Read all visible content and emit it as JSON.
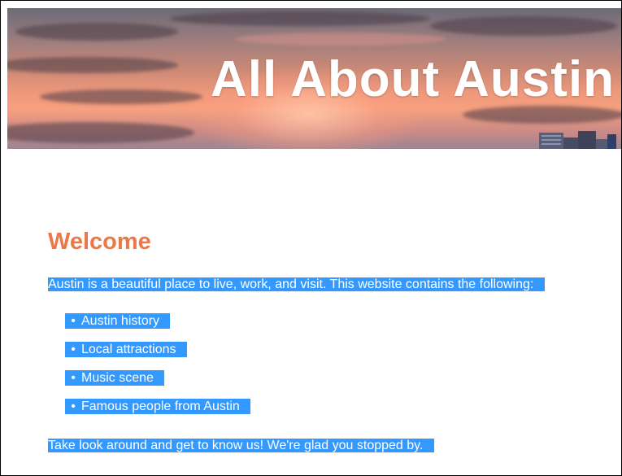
{
  "banner": {
    "title": "All About Austin",
    "image_alt": "sunset-sky-over-austin-skyline"
  },
  "welcome": {
    "heading": "Welcome",
    "intro": "Austin is a beautiful place to live, work, and visit. This website contains the following:",
    "items": [
      {
        "label": "Austin history"
      },
      {
        "label": "Local attractions"
      },
      {
        "label": "Music scene"
      },
      {
        "label": "Famous people from Austin"
      }
    ],
    "bullet": "•",
    "outro": "Take look around and get to know us! We're glad you stopped by."
  },
  "colors": {
    "heading": "#ee7748",
    "selection_bg": "#3399ff",
    "selection_text": "#ffffff",
    "banner_title": "#ffffff",
    "border": "#000000"
  }
}
